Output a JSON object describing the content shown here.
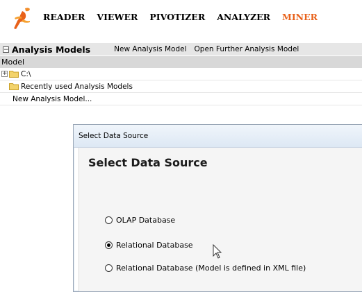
{
  "nav": {
    "items": [
      {
        "label": "READER",
        "active": false
      },
      {
        "label": "VIEWER",
        "active": false
      },
      {
        "label": "PIVOTIZER",
        "active": false
      },
      {
        "label": "ANALYZER",
        "active": false
      },
      {
        "label": "MINER",
        "active": true
      }
    ],
    "active_color": "#e8611a"
  },
  "toolbar": {
    "collapse_glyph": "⊟",
    "title": "Analysis Models",
    "links": [
      "New Analysis Model",
      "Open Further Analysis Model"
    ]
  },
  "tree": {
    "column_header": "Model",
    "rows": [
      {
        "label": "C:\\",
        "expander": "+",
        "folder": true
      },
      {
        "label": "Recently used Analysis Models",
        "expander": "",
        "folder": true
      },
      {
        "label": "New Analysis Model...",
        "expander": "",
        "folder": false
      }
    ]
  },
  "dialog": {
    "title": "Select Data Source",
    "heading": "Select Data Source",
    "options": [
      {
        "label": "OLAP Database",
        "checked": false
      },
      {
        "label": "Relational Database",
        "checked": true
      },
      {
        "label": "Relational Database (Model is defined in XML file)",
        "checked": false
      }
    ]
  }
}
